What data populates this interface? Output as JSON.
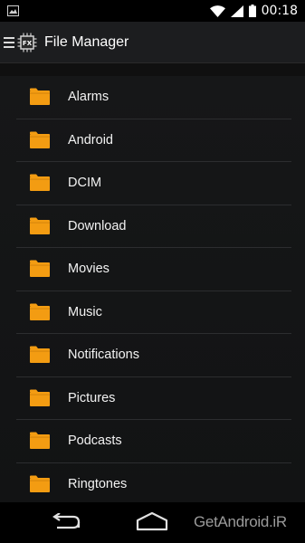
{
  "status_bar": {
    "time": "00:18"
  },
  "action_bar": {
    "title": "File Manager",
    "app_icon_text": "FX"
  },
  "folders": [
    {
      "label": "Alarms"
    },
    {
      "label": "Android"
    },
    {
      "label": "DCIM"
    },
    {
      "label": "Download"
    },
    {
      "label": "Movies"
    },
    {
      "label": "Music"
    },
    {
      "label": "Notifications"
    },
    {
      "label": "Pictures"
    },
    {
      "label": "Podcasts"
    },
    {
      "label": "Ringtones"
    }
  ],
  "watermark": "GetAndroid.iR",
  "colors": {
    "folder": "#f39c12",
    "background": "#141516",
    "divider": "#2c2d2f"
  },
  "icons": {
    "status_left": "image-notification-icon",
    "wifi": "wifi-icon",
    "signal": "signal-icon",
    "battery": "battery-full-icon",
    "menu": "hamburger-icon",
    "folder": "folder-icon",
    "back": "back-icon",
    "home": "home-icon"
  }
}
